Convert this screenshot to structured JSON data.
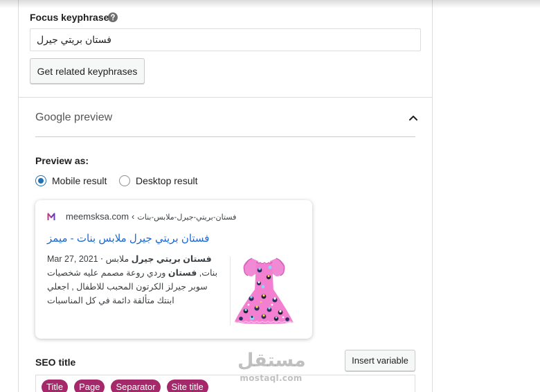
{
  "colors": {
    "radio_accent": "#2271b1",
    "result_title": "#1967d2",
    "variable_pill": "#a4286a"
  },
  "focus_keyphrase": {
    "label": "Focus keyphrase",
    "help_icon": "help-icon",
    "value": "فستان بريتي جيرل",
    "related_button": "Get related keyphrases"
  },
  "google_preview": {
    "heading": "Google preview",
    "toggle_icon": "chevron-up-icon",
    "preview_as_label": "Preview as:",
    "modes": [
      {
        "label": "Mobile result",
        "checked": true
      },
      {
        "label": "Desktop result",
        "checked": false
      }
    ],
    "result": {
      "favicon_icon": "site-favicon-icon",
      "domain": "meemsksa.com",
      "separator": "‹",
      "path": "فستان-بريتي-جيرل-ملابس-بنات",
      "title": "فستان بريتي جيرل ملابس بنات - ميمز",
      "date": "Mar 27, 2021",
      "date_separator": "⋅",
      "description": [
        {
          "text": "فستان بريتي جيرل",
          "bold": true
        },
        {
          "text": " ملابس بنات, ",
          "bold": false
        },
        {
          "text": "فستان",
          "bold": true
        },
        {
          "text": " وردي روعة مصمم عليه شخصيات سوبر جيرلز الكرتون المحبب للاطفال , اجعلي ابنتك متألقة دائمة في كل المناسبات",
          "bold": false
        }
      ]
    }
  },
  "seo_title": {
    "label": "SEO title",
    "insert_variable_button": "Insert variable",
    "variables": [
      "Title",
      "Page",
      "Separator",
      "Site title"
    ]
  },
  "watermark": {
    "arabic": "مستقل",
    "latin": "mostaql.com"
  }
}
